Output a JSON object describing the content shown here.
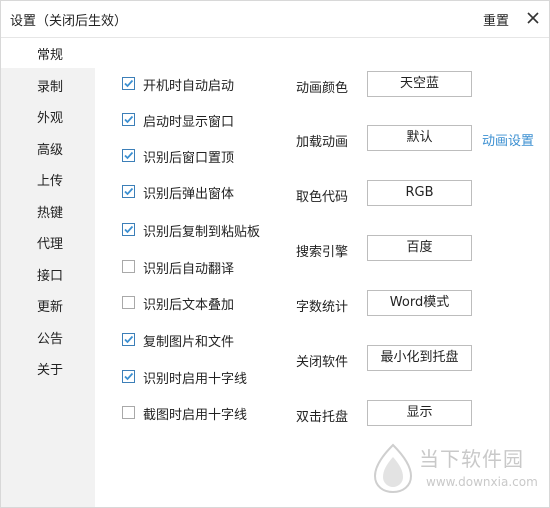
{
  "window": {
    "title": "设置（关闭后生效）",
    "reset_label": "重置",
    "close_icon": "close-icon"
  },
  "sidebar": {
    "active_index": 0,
    "items": [
      {
        "label": "常规"
      },
      {
        "label": "录制"
      },
      {
        "label": "外观"
      },
      {
        "label": "高级"
      },
      {
        "label": "上传"
      },
      {
        "label": "热键"
      },
      {
        "label": "代理"
      },
      {
        "label": "接口"
      },
      {
        "label": "更新"
      },
      {
        "label": "公告"
      },
      {
        "label": "关于"
      }
    ]
  },
  "checkboxes": [
    {
      "label": "开机时自动启动",
      "checked": true
    },
    {
      "label": "启动时显示窗口",
      "checked": true
    },
    {
      "label": "识别后窗口置顶",
      "checked": true
    },
    {
      "label": "识别后弹出窗体",
      "checked": true
    },
    {
      "label": "识别后复制到粘贴板",
      "checked": true
    },
    {
      "label": "识别后自动翻译",
      "checked": false
    },
    {
      "label": "识别后文本叠加",
      "checked": false
    },
    {
      "label": "复制图片和文件",
      "checked": true
    },
    {
      "label": "识别时启用十字线",
      "checked": true
    },
    {
      "label": "截图时启用十字线",
      "checked": false
    }
  ],
  "settings": [
    {
      "label": "动画颜色",
      "value": "天空蓝"
    },
    {
      "label": "加载动画",
      "value": "默认",
      "link": "动画设置"
    },
    {
      "label": "取色代码",
      "value": "RGB"
    },
    {
      "label": "搜索引擎",
      "value": "百度"
    },
    {
      "label": "字数统计",
      "value": "Word模式"
    },
    {
      "label": "关闭软件",
      "value": "最小化到托盘"
    },
    {
      "label": "双击托盘",
      "value": "显示"
    }
  ],
  "watermark": {
    "text": "当下软件园",
    "url": "www.downxia.com"
  },
  "colors": {
    "accent": "#3b8fd1",
    "sidebar_bg": "#f2f2f2"
  }
}
